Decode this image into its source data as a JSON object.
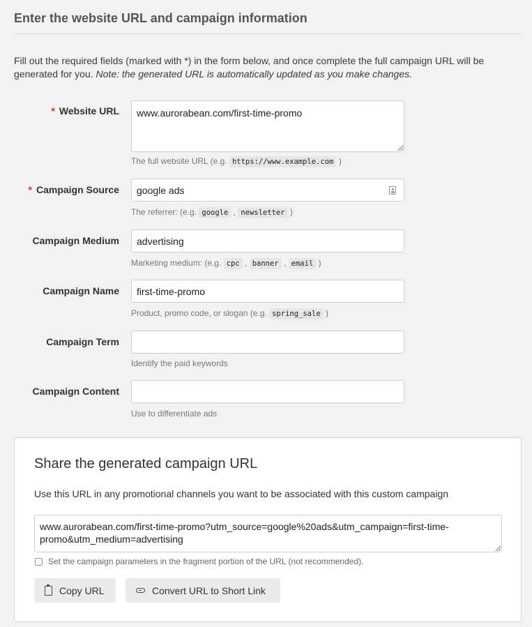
{
  "page": {
    "heading": "Enter the website URL and campaign information",
    "intro_text": "Fill out the required fields (marked with *) in the form below, and once complete the full campaign URL will be generated for you. ",
    "intro_note": "Note: the generated URL is automatically updated as you make changes."
  },
  "form": {
    "required_marker": "*",
    "fields": [
      {
        "label": "Website URL",
        "required": true,
        "value": "www.aurorabean.com/first-time-promo",
        "placeholder": "",
        "help_prefix": "The full website URL (e.g. ",
        "help_codes": [
          "https://www.example.com"
        ],
        "help_suffix": ")"
      },
      {
        "label": "Campaign Source",
        "required": true,
        "value": "google ads",
        "placeholder": "",
        "icon": "contact-card-icon",
        "help_prefix": "The referrer: (e.g. ",
        "help_codes": [
          "google",
          "newsletter"
        ],
        "help_suffix": ")"
      },
      {
        "label": "Campaign Medium",
        "required": false,
        "value": "advertising",
        "placeholder": "",
        "help_prefix": "Marketing medium: (e.g. ",
        "help_codes": [
          "cpc",
          "banner",
          "email"
        ],
        "help_suffix": ")"
      },
      {
        "label": "Campaign Name",
        "required": false,
        "value": "first-time-promo",
        "placeholder": "",
        "help_prefix": "Product, promo code, or slogan (e.g. ",
        "help_codes": [
          "spring_sale"
        ],
        "help_suffix": ")"
      },
      {
        "label": "Campaign Term",
        "required": false,
        "value": "",
        "placeholder": "",
        "help_text": "Identify the paid keywords"
      },
      {
        "label": "Campaign Content",
        "required": false,
        "value": "",
        "placeholder": "",
        "help_text": "Use to differentiate ads"
      }
    ]
  },
  "share": {
    "title": "Share the generated campaign URL",
    "description": "Use this URL in any promotional channels you want to be associated with this custom campaign",
    "generated_url": "www.aurorabean.com/first-time-promo?utm_source=google%20ads&utm_campaign=first-time-promo&utm_medium=advertising",
    "fragment_checkbox_label": "Set the campaign parameters in the fragment portion of the URL (not recommended).",
    "fragment_checked": false,
    "copy_button": "Copy URL",
    "short_link_button": "Convert URL to Short Link"
  },
  "colors": {
    "background": "#f3f2f0",
    "required": "#d9312b",
    "button_bg": "#ebebeb",
    "panel_bg": "#ffffff"
  }
}
